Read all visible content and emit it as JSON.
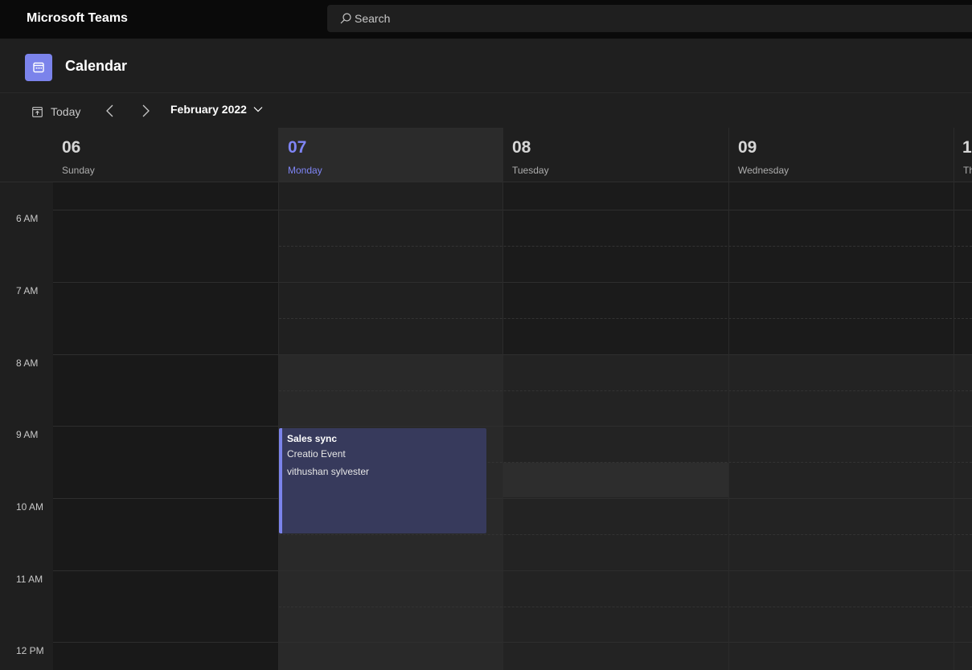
{
  "titlebar": {
    "app_name": "Microsoft Teams",
    "search_placeholder": "Search"
  },
  "header": {
    "title": "Calendar"
  },
  "toolbar": {
    "today_label": "Today",
    "month_label": "February 2022"
  },
  "days": [
    {
      "num": "06",
      "name": "Sunday",
      "is_today": false
    },
    {
      "num": "07",
      "name": "Monday",
      "is_today": true
    },
    {
      "num": "08",
      "name": "Tuesday",
      "is_today": false
    },
    {
      "num": "09",
      "name": "Wednesday",
      "is_today": false
    },
    {
      "num": "1",
      "name": "Th",
      "is_today": false
    }
  ],
  "time_labels": [
    "6 AM",
    "7 AM",
    "8 AM",
    "9 AM",
    "10 AM",
    "11 AM",
    "12 PM"
  ],
  "event": {
    "title": "Sales sync",
    "location": "Creatio Event",
    "organizer": "vithushan sylvester",
    "accent_color": "#7b83eb",
    "bg_color": "#373a5c",
    "start": "9:00 AM",
    "end": "10:30 AM"
  },
  "colors": {
    "today": "#7f85f5",
    "app_icon": "#7b83eb"
  }
}
